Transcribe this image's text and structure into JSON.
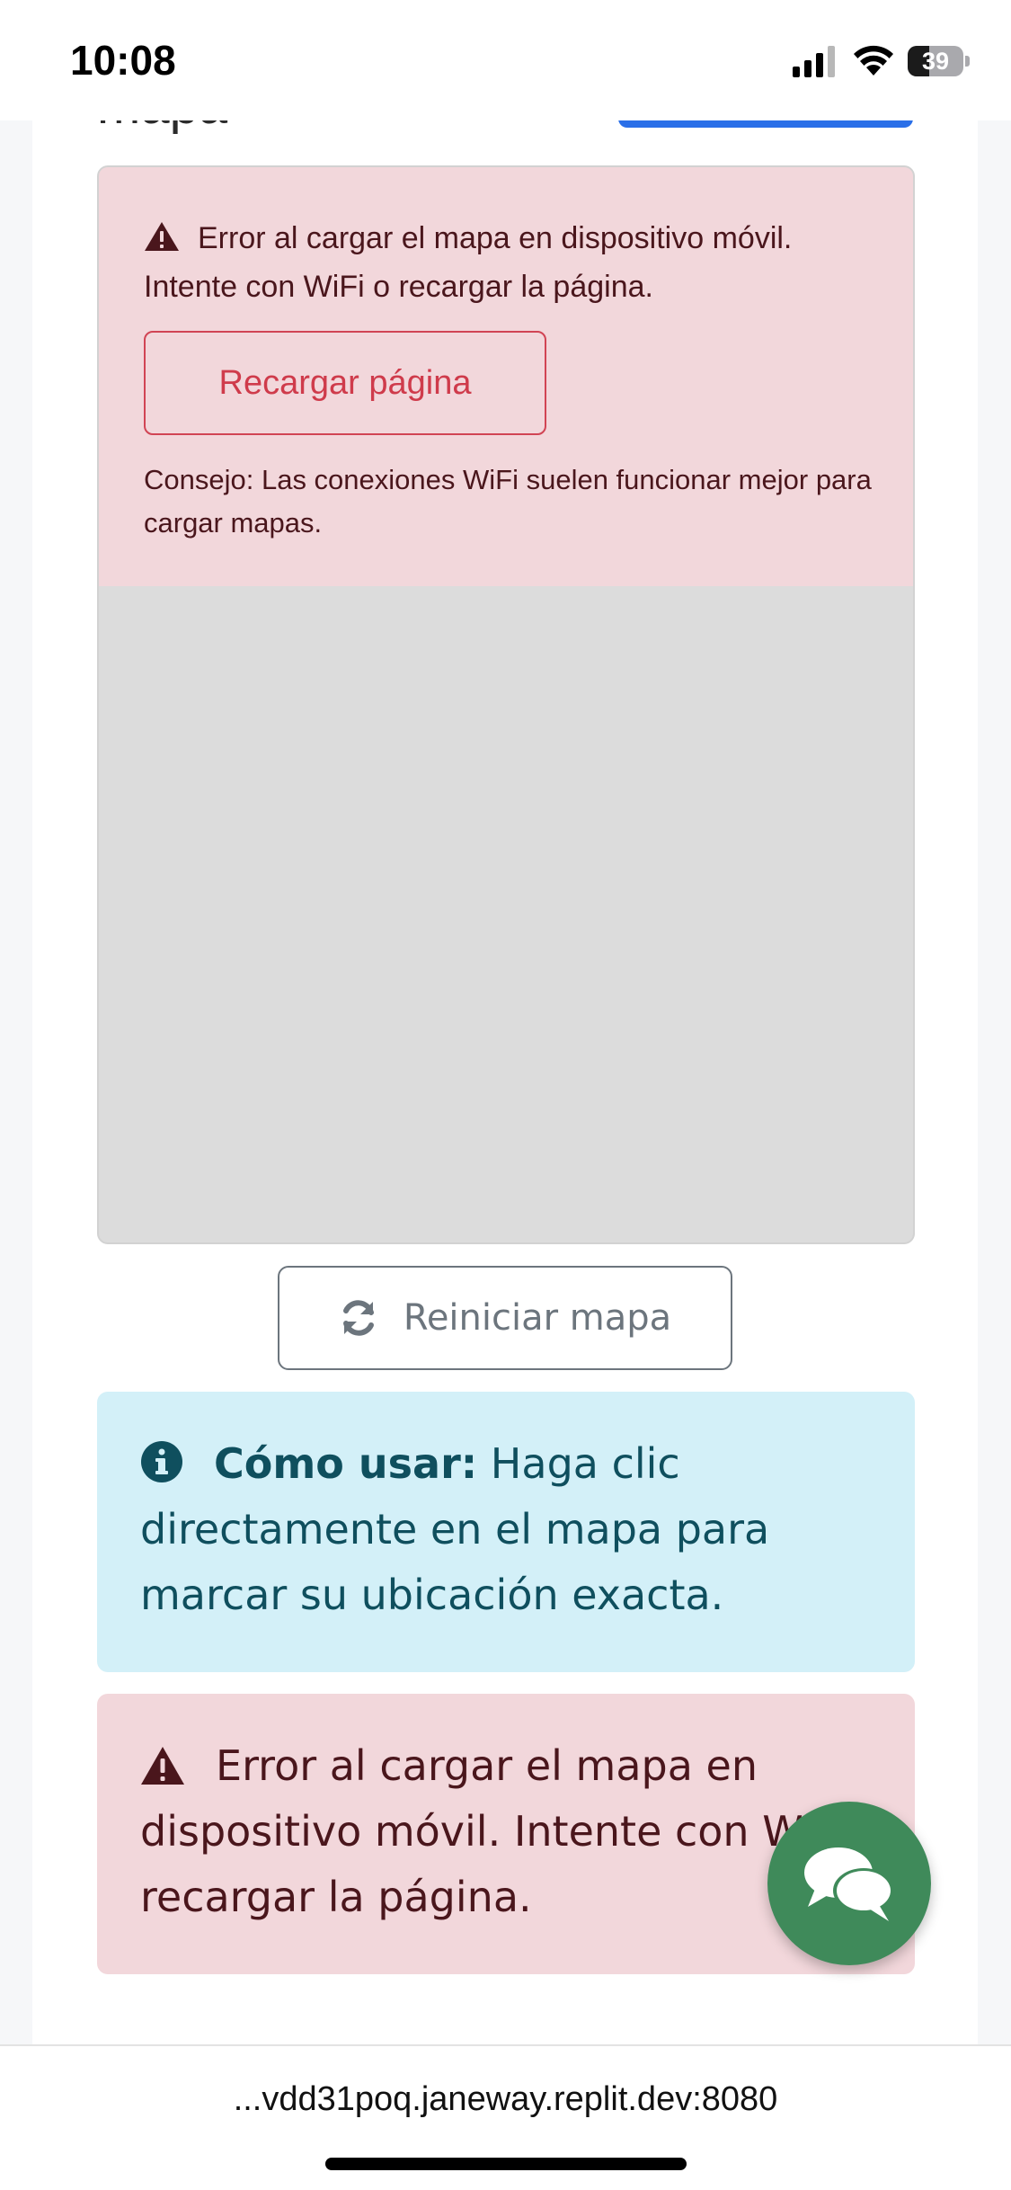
{
  "status_bar": {
    "time": "10:08",
    "battery_level": "39",
    "battery_fraction": 0.39
  },
  "page": {
    "title_partial": "mapa"
  },
  "map": {
    "error_message": "Error al cargar el mapa en dispositivo móvil. Intente con WiFi o recargar la página.",
    "reload_button": "Recargar página",
    "tip": "Consejo: Las conexiones WiFi suelen funcionar mejor para cargar mapas."
  },
  "reset_button": {
    "label": "Reiniciar mapa"
  },
  "info_alert": {
    "strong": "Cómo usar:",
    "text": " Haga clic directamente en el mapa para marcar su ubicación exacta."
  },
  "error_alert": {
    "text": "Error al cargar el mapa en dispositivo móvil. Intente con WiFi o recargar la página."
  },
  "browser": {
    "url": "...vdd31poq.janeway.replit.dev:8080"
  },
  "colors": {
    "danger_bg": "#f2d7db",
    "danger_text": "#4a161c",
    "danger_button": "#cf3b4b",
    "info_bg": "#d3f0f8",
    "info_text": "#0f4f5e",
    "primary": "#2a6fe8",
    "chat_fab": "#3f8a5a"
  },
  "icons": {
    "status": [
      "signal-icon",
      "wifi-icon",
      "battery-icon"
    ],
    "alerts": [
      "warning-triangle-icon",
      "info-circle-icon",
      "refresh-icon",
      "chat-bubbles-icon"
    ]
  }
}
